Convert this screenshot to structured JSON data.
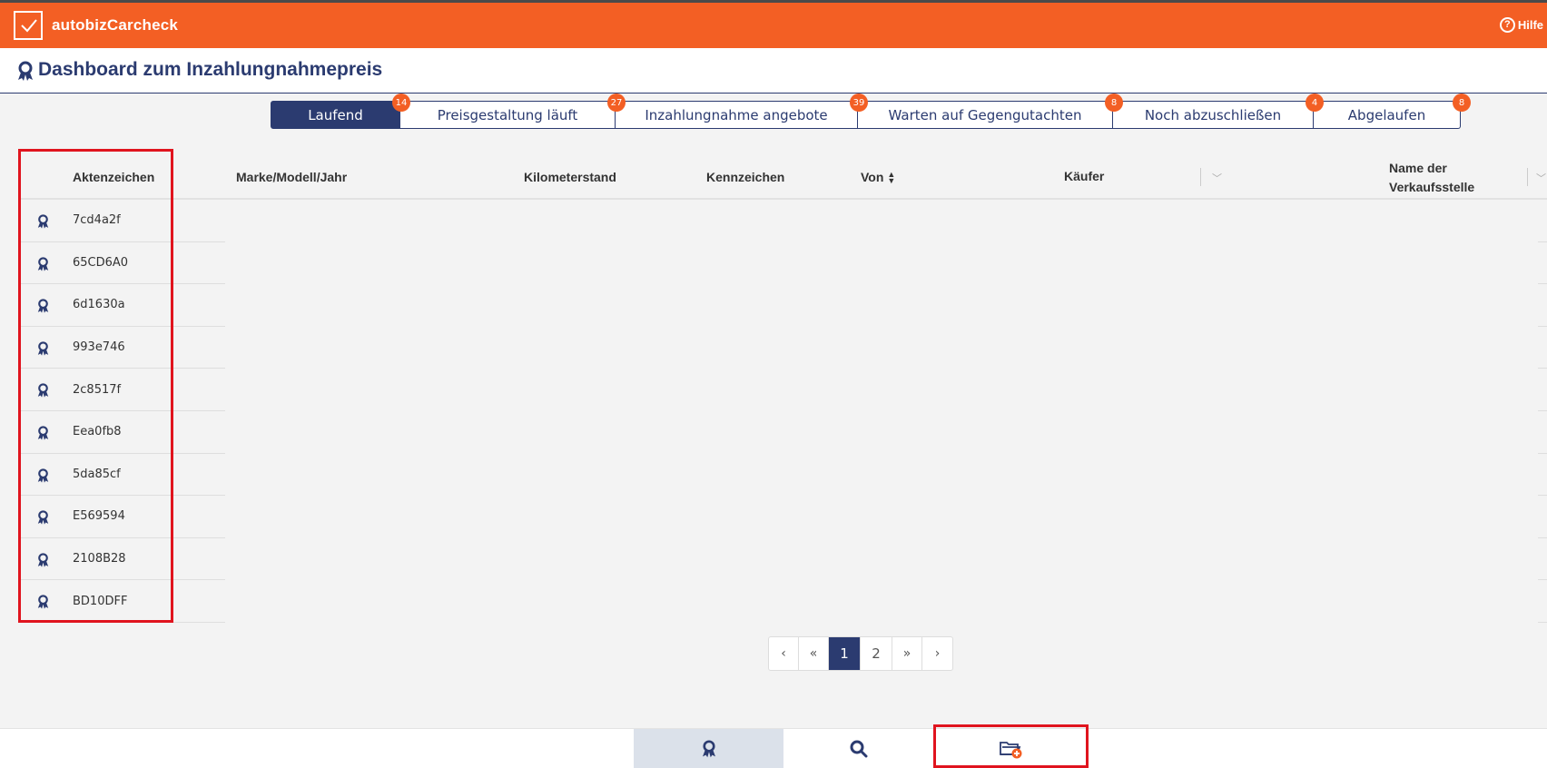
{
  "app": {
    "brand": "autobizCarcheck",
    "help_label": "Hilfe"
  },
  "page": {
    "title": "Dashboard zum Inzahlungnahmepreis"
  },
  "tabs": [
    {
      "label": "Laufend",
      "count": "14",
      "active": true
    },
    {
      "label": "Preisgestaltung läuft",
      "count": "27"
    },
    {
      "label": "Inzahlungnahme angebote",
      "count": "39"
    },
    {
      "label": "Warten auf Gegengutachten",
      "count": "8"
    },
    {
      "label": "Noch abzuschließen",
      "count": "4"
    },
    {
      "label": "Abgelaufen",
      "count": "8"
    }
  ],
  "table": {
    "columns": {
      "aktenzeichen": "Aktenzeichen",
      "marke": "Marke/Modell/Jahr",
      "kilometer": "Kilometerstand",
      "kennzeichen": "Kennzeichen",
      "von": "Von",
      "kaeufer": "Käufer",
      "verkaufsstelle_line1": "Name der",
      "verkaufsstelle_line2": "Verkaufsstelle"
    },
    "rows": [
      "7cd4a2f",
      "65CD6A0",
      "6d1630a",
      "993e746",
      "2c8517f",
      "Eea0fb8",
      "5da85cf",
      "E569594",
      "2108B28",
      "BD10DFF"
    ]
  },
  "pagination": {
    "prev": "‹",
    "first": "«",
    "pages": [
      "1",
      "2"
    ],
    "active_page": "1",
    "last": "»",
    "next": "›"
  },
  "colors": {
    "brand_orange": "#f35f24",
    "navy": "#2b3b70",
    "highlight_red": "#e0141e"
  },
  "icons": {
    "logo": "check-icon",
    "help": "question-circle-icon",
    "row": "award-ribbon-icon",
    "bottom": [
      "award-ribbon-icon",
      "search-icon",
      "folder-add-icon"
    ]
  }
}
